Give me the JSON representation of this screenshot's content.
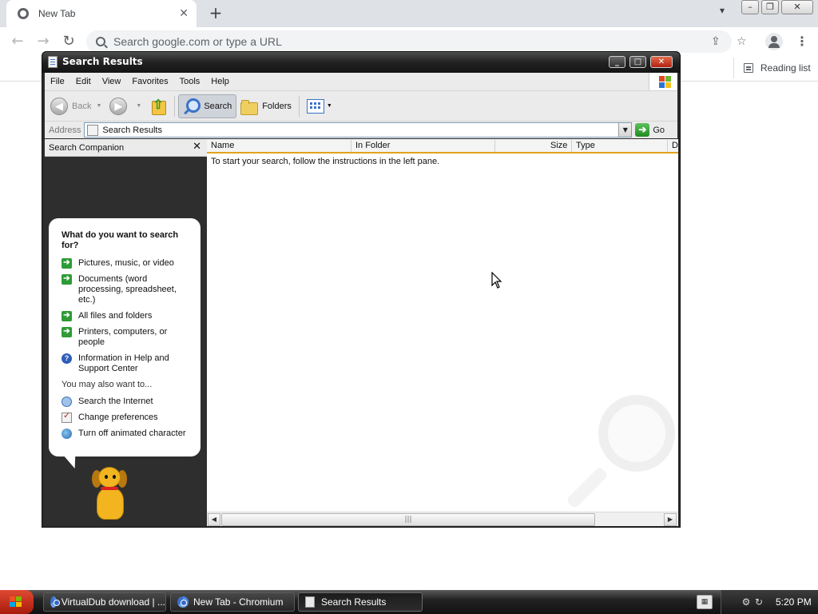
{
  "browser": {
    "tab": {
      "title": "New Tab",
      "close": "✕"
    },
    "new_tab_label": "+",
    "omnibox": {
      "placeholder": "Search google.com or type a URL"
    },
    "reading_list_label": "Reading list",
    "nav": {
      "back": "←",
      "forward": "→",
      "reload": "↻"
    }
  },
  "explorer": {
    "title": "Search Results",
    "title_buttons": {
      "minimize": "_",
      "maximize": "□",
      "close": "✕"
    },
    "menu": [
      "File",
      "Edit",
      "View",
      "Favorites",
      "Tools",
      "Help"
    ],
    "toolbar": {
      "back": "Back",
      "search": "Search",
      "folders": "Folders"
    },
    "address": {
      "label": "Address",
      "value": "Search Results",
      "go": "Go"
    },
    "companion": {
      "title": "Search Companion",
      "question": "What do you want to search for?",
      "options": [
        "Pictures, music, or video",
        "Documents (word processing, spreadsheet, etc.)",
        "All files and folders",
        "Printers, computers, or people",
        "Information in Help and Support Center"
      ],
      "also_label": "You may also want to...",
      "also_options": [
        "Search the Internet",
        "Change preferences",
        "Turn off animated character"
      ]
    },
    "columns": [
      "Name",
      "In Folder",
      "Size",
      "Type",
      "D"
    ],
    "message": "To start your search, follow the instructions in the left pane."
  },
  "taskbar": {
    "tasks": [
      "VirtualDub download | ...",
      "New Tab - Chromium",
      "Search Results"
    ],
    "clock": "5:20 PM"
  },
  "colors": {
    "column_header_accent": "#e3a21a",
    "start_button": "#c0321e",
    "green_arrow": "#2e9b36"
  }
}
